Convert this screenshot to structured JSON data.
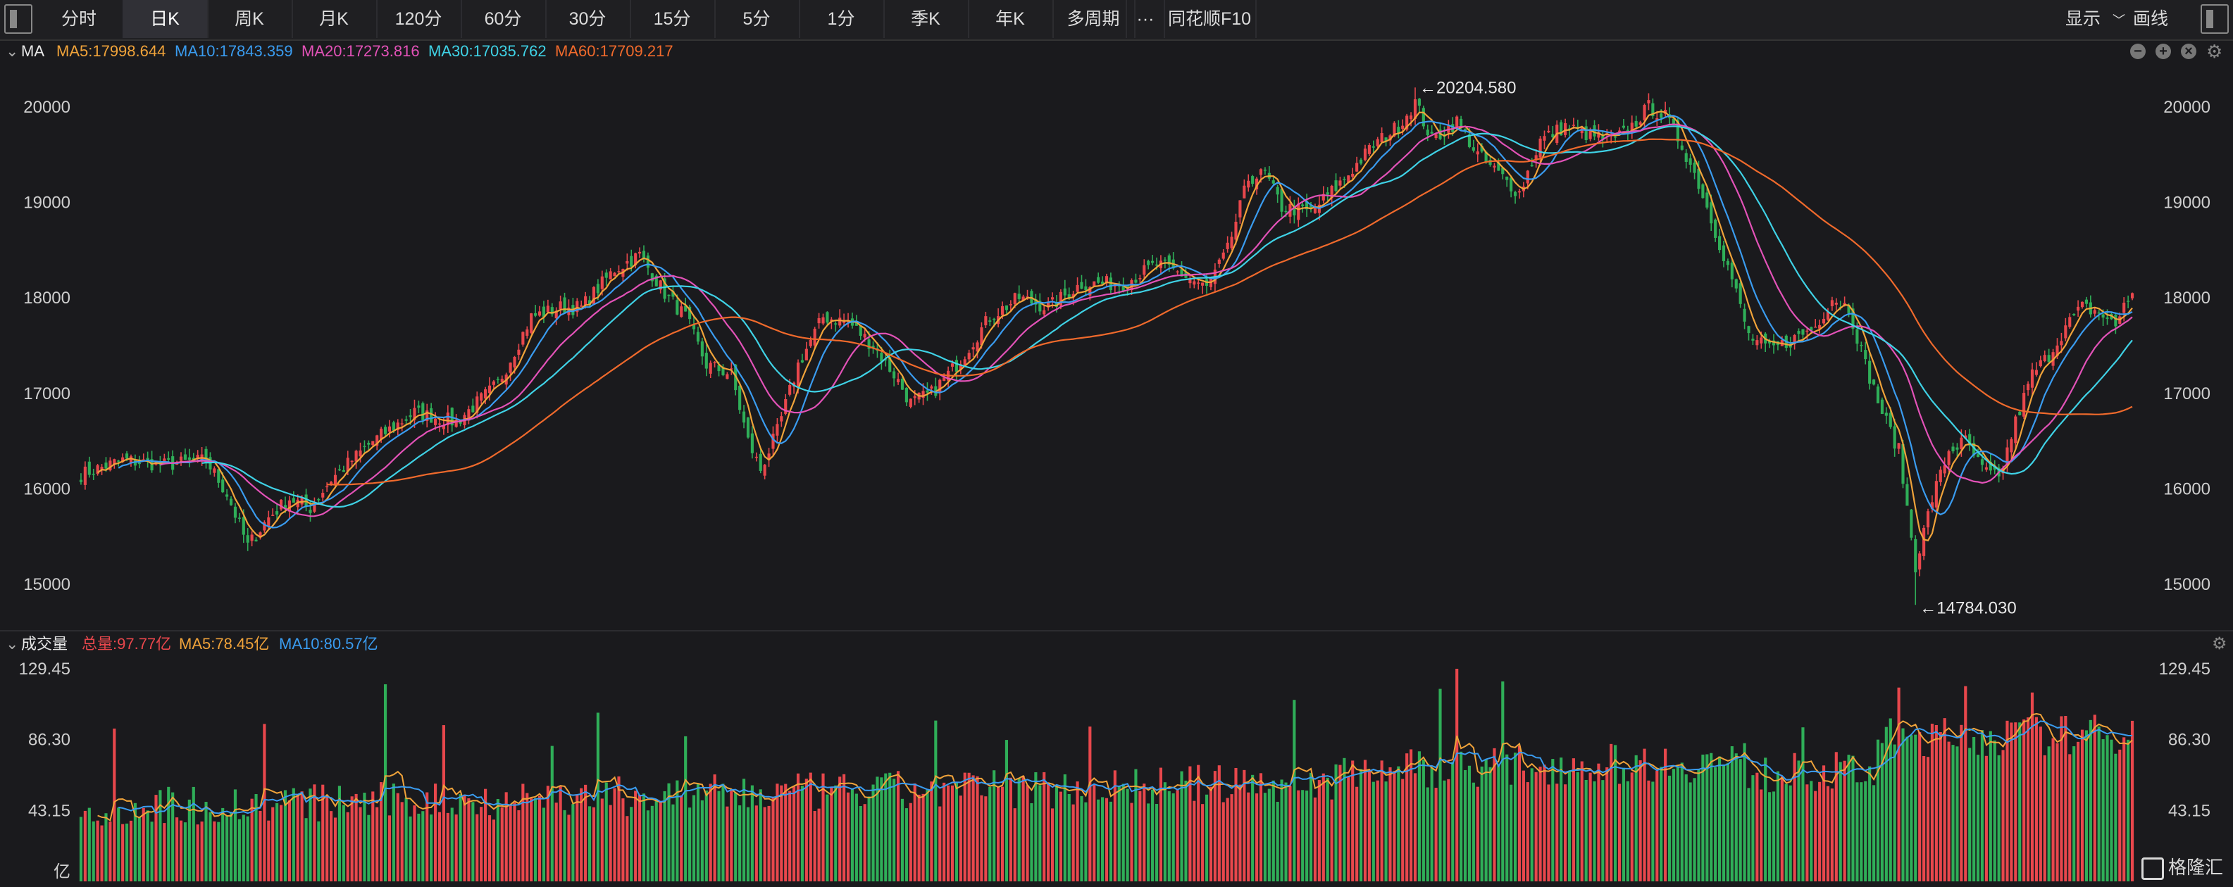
{
  "toolbar": {
    "tabs": [
      "分时",
      "日K",
      "周K",
      "月K",
      "120分",
      "60分",
      "30分",
      "15分",
      "5分",
      "1分",
      "季K",
      "年K",
      "多周期"
    ],
    "active_tab": "日K",
    "more": "···",
    "f10": "同花顺F10",
    "display": "显示",
    "draw": "画线"
  },
  "main_legend": {
    "indicator": "MA",
    "ma5": "MA5:17998.644",
    "ma10": "MA10:17843.359",
    "ma20": "MA20:17273.816",
    "ma30": "MA30:17035.762",
    "ma60": "MA60:17709.217"
  },
  "volume_legend": {
    "title": "成交量",
    "total": "总量:97.77亿",
    "ma5": "MA5:78.45亿",
    "ma10": "MA10:80.57亿"
  },
  "colors": {
    "up": "#e8474c",
    "down": "#2fae58",
    "ma5": "#f0a33a",
    "ma10": "#3a9cf0",
    "ma20": "#e352b8",
    "ma30": "#3fd2e6",
    "ma60": "#f06a2c"
  },
  "watermark": "格隆汇",
  "chart_data": [
    {
      "type": "candlestick",
      "y_ticks": [
        "20000",
        "19000",
        "18000",
        "17000",
        "16000",
        "15000"
      ],
      "ylim": [
        14700,
        20500
      ],
      "annotations": {
        "high": "←20204.580",
        "low": "←14784.030"
      },
      "high_value": 20204.58,
      "low_value": 14784.03,
      "key_closes": [
        [
          0,
          16150
        ],
        [
          10,
          16300
        ],
        [
          20,
          16250
        ],
        [
          30,
          16300
        ],
        [
          35,
          15950
        ],
        [
          40,
          15400
        ],
        [
          45,
          15700
        ],
        [
          50,
          15900
        ],
        [
          55,
          15800
        ],
        [
          60,
          16100
        ],
        [
          70,
          16500
        ],
        [
          80,
          16800
        ],
        [
          90,
          16700
        ],
        [
          100,
          17100
        ],
        [
          108,
          17800
        ],
        [
          115,
          17900
        ],
        [
          120,
          17900
        ],
        [
          128,
          18300
        ],
        [
          134,
          18450
        ],
        [
          140,
          18050
        ],
        [
          145,
          17800
        ],
        [
          150,
          17300
        ],
        [
          156,
          17200
        ],
        [
          160,
          16500
        ],
        [
          163,
          16200
        ],
        [
          167,
          16600
        ],
        [
          172,
          17300
        ],
        [
          178,
          17800
        ],
        [
          184,
          17750
        ],
        [
          190,
          17500
        ],
        [
          195,
          17200
        ],
        [
          199,
          16900
        ],
        [
          204,
          17000
        ],
        [
          210,
          17300
        ],
        [
          218,
          17800
        ],
        [
          225,
          18000
        ],
        [
          232,
          17900
        ],
        [
          240,
          18150
        ],
        [
          250,
          18150
        ],
        [
          258,
          18350
        ],
        [
          264,
          18250
        ],
        [
          270,
          18100
        ],
        [
          275,
          18500
        ],
        [
          280,
          19250
        ],
        [
          284,
          19300
        ],
        [
          288,
          18950
        ],
        [
          295,
          18900
        ],
        [
          302,
          19200
        ],
        [
          310,
          19600
        ],
        [
          316,
          19800
        ],
        [
          320,
          20050
        ],
        [
          324,
          19650
        ],
        [
          330,
          19850
        ],
        [
          335,
          19500
        ],
        [
          340,
          19300
        ],
        [
          345,
          19100
        ],
        [
          350,
          19650
        ],
        [
          356,
          19800
        ],
        [
          362,
          19700
        ],
        [
          368,
          19650
        ],
        [
          372,
          19800
        ],
        [
          376,
          20000
        ],
        [
          380,
          19900
        ],
        [
          384,
          19600
        ],
        [
          388,
          19200
        ],
        [
          392,
          18700
        ],
        [
          396,
          18200
        ],
        [
          400,
          17600
        ],
        [
          405,
          17450
        ],
        [
          410,
          17550
        ],
        [
          416,
          17700
        ],
        [
          420,
          18000
        ],
        [
          424,
          17900
        ],
        [
          428,
          17300
        ],
        [
          432,
          16800
        ],
        [
          436,
          16400
        ],
        [
          440,
          15200
        ],
        [
          444,
          15900
        ],
        [
          448,
          16400
        ],
        [
          452,
          16500
        ],
        [
          456,
          16200
        ],
        [
          460,
          16100
        ],
        [
          464,
          16700
        ],
        [
          468,
          17200
        ],
        [
          472,
          17400
        ],
        [
          476,
          17700
        ],
        [
          480,
          17900
        ],
        [
          484,
          17850
        ],
        [
          488,
          17700
        ],
        [
          490,
          17950
        ],
        [
          492,
          18050
        ]
      ],
      "ma_last": {
        "MA5": 17998.644,
        "MA10": 17843.359,
        "MA20": 17273.816,
        "MA30": 17035.762,
        "MA60": 17709.217
      }
    },
    {
      "type": "bar",
      "y_ticks": [
        "129.45",
        "86.30",
        "43.15"
      ],
      "unit": "亿",
      "ylim": [
        0,
        129.45
      ],
      "last_total": 97.77,
      "ma5_last": 78.45,
      "ma10_last": 80.57
    }
  ]
}
